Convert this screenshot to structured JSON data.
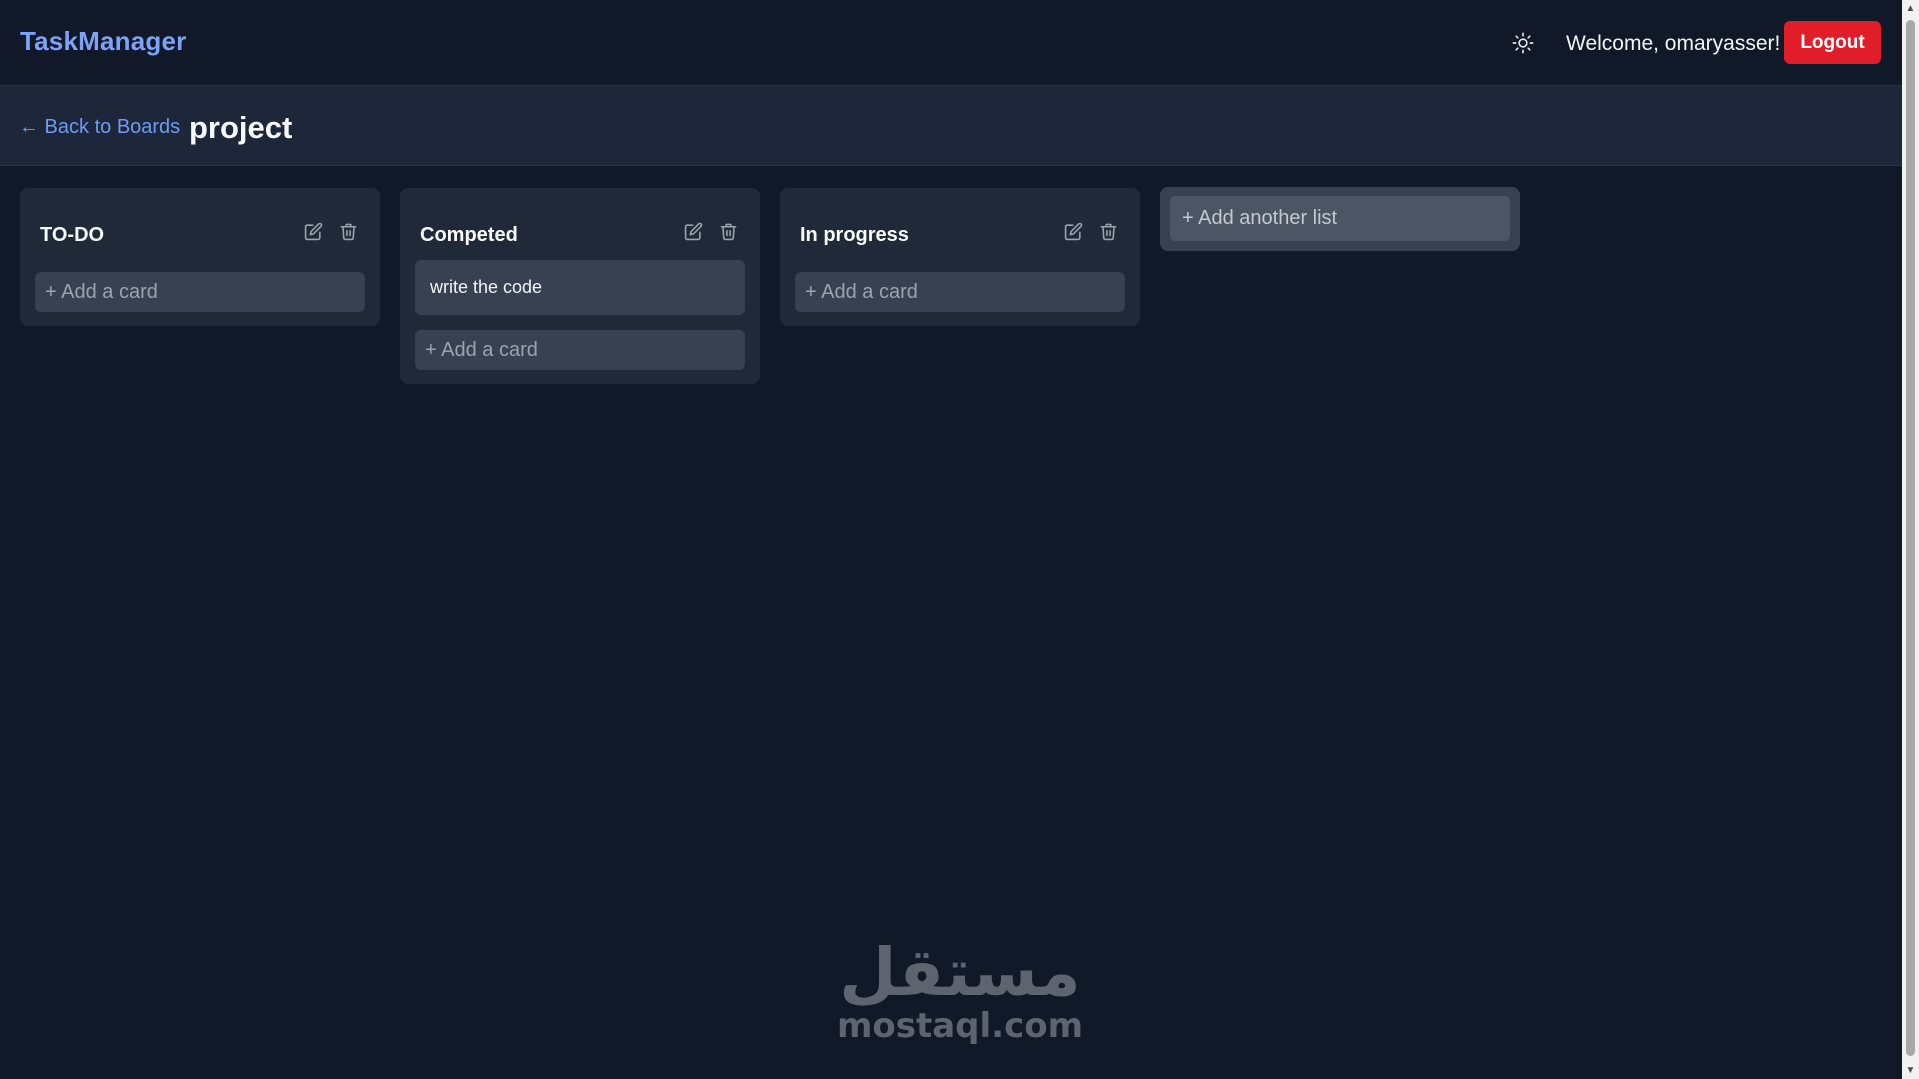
{
  "app": {
    "brand": "TaskManager",
    "welcome": "Welcome, omaryasser!",
    "logout_label": "Logout",
    "theme_icon": "sun-icon"
  },
  "board": {
    "back_label": "← Back to Boards",
    "title": "project"
  },
  "lists": [
    {
      "title": "TO-DO",
      "cards": [],
      "add_card_label": "+ Add a card"
    },
    {
      "title": "Competed",
      "cards": [
        {
          "text": "write the code"
        }
      ],
      "add_card_label": "+ Add a card"
    },
    {
      "title": "In progress",
      "cards": [],
      "add_card_label": "+ Add a card"
    }
  ],
  "add_list": {
    "placeholder": "+ Add another list"
  },
  "watermark": {
    "logo": "مستقل",
    "url": "mostaql.com"
  },
  "colors": {
    "background": "#111827",
    "header": "#1d2739",
    "list": "#1f2937",
    "card": "#374151",
    "brand": "#7ea2f7",
    "link": "#6e9bf5",
    "logout": "#e11d2a"
  }
}
